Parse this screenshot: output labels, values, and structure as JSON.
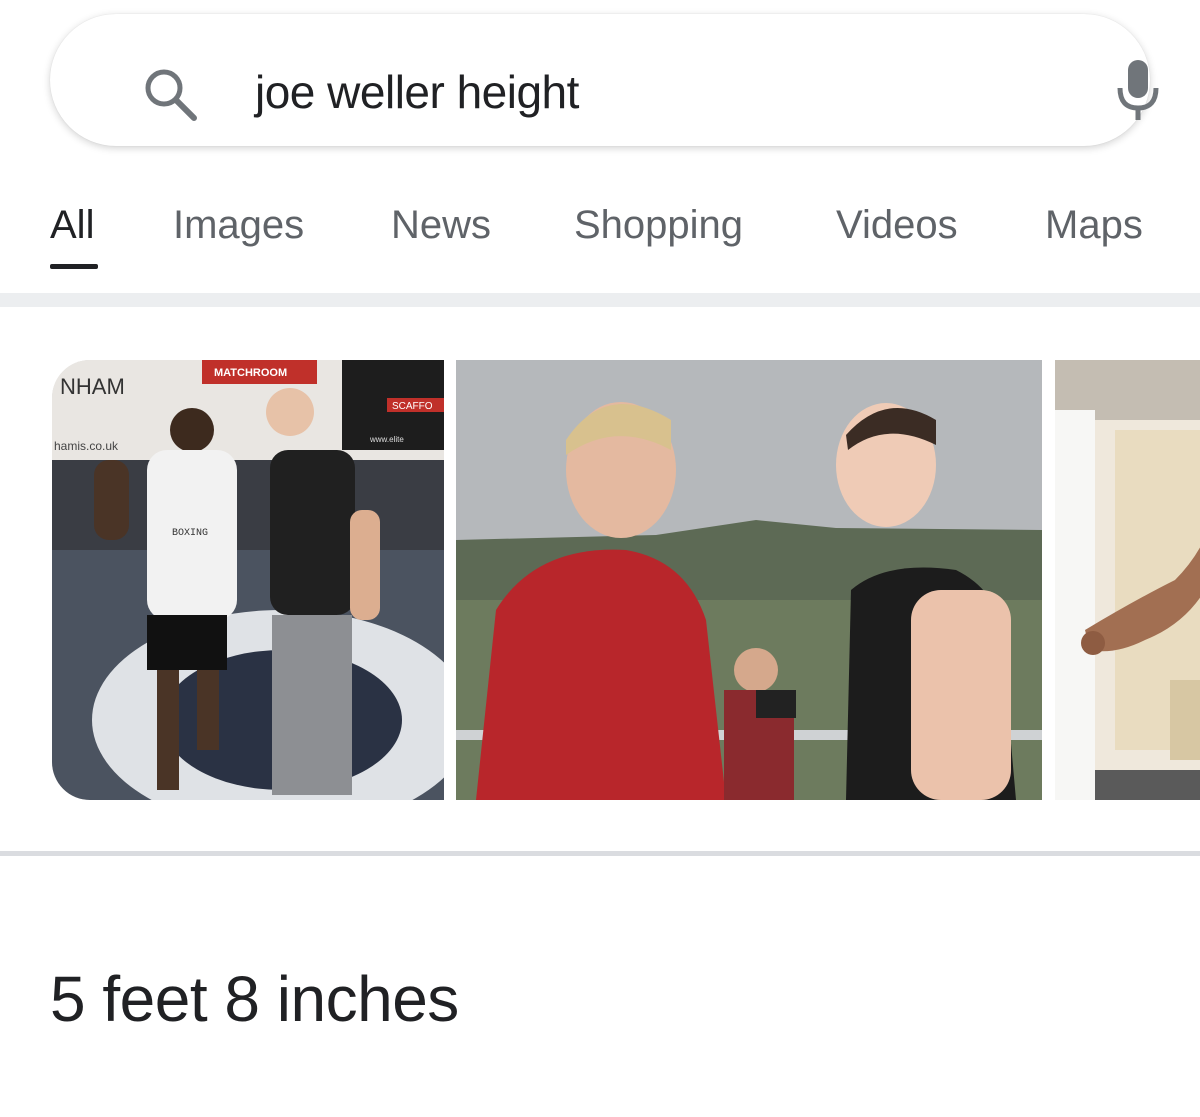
{
  "search": {
    "query": "joe weller height",
    "icon": "search-icon",
    "voice_icon": "mic-icon"
  },
  "tabs": [
    {
      "label": "All",
      "active": true
    },
    {
      "label": "Images",
      "active": false
    },
    {
      "label": "News",
      "active": false
    },
    {
      "label": "Shopping",
      "active": false
    },
    {
      "label": "Videos",
      "active": false
    },
    {
      "label": "Maps",
      "active": false
    }
  ],
  "images": [
    {
      "text": [
        "NHAM",
        "hamis.co.uk",
        "MATCHROOM",
        "BOXING",
        "SCAFFO",
        "www.elite"
      ]
    },
    {
      "text": []
    },
    {
      "text": []
    }
  ],
  "answer": {
    "value": "5 feet 8 inches"
  },
  "colors": {
    "text_primary": "#202124",
    "text_secondary": "#5f6368",
    "divider": "#dadce0"
  }
}
